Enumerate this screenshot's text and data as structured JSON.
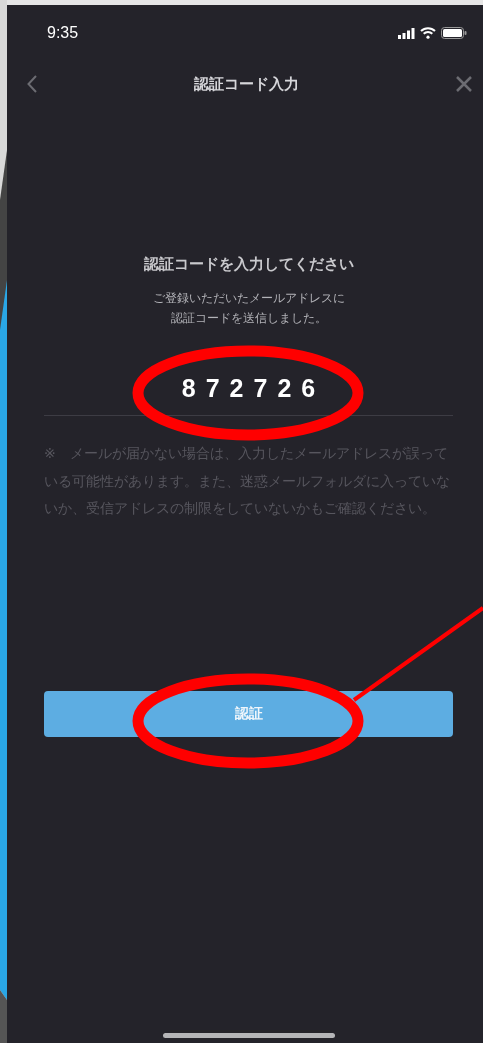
{
  "status_bar": {
    "time": "9:35"
  },
  "nav_bar": {
    "title": "認証コード入力"
  },
  "heading": "認証コードを入力してください",
  "subtitle": [
    "ご登録いただいたメールアドレスに",
    "認証コードを送信しました。"
  ],
  "code_field": {
    "value": "872726"
  },
  "notice": "※　メールが届かない場合は、入力したメールアドレスが誤っている可能性があります。また、迷惑メールフォルダに入っていないか、受信アドレスの制限をしていないかもご確認ください。",
  "submit_button": {
    "label": "認証"
  }
}
